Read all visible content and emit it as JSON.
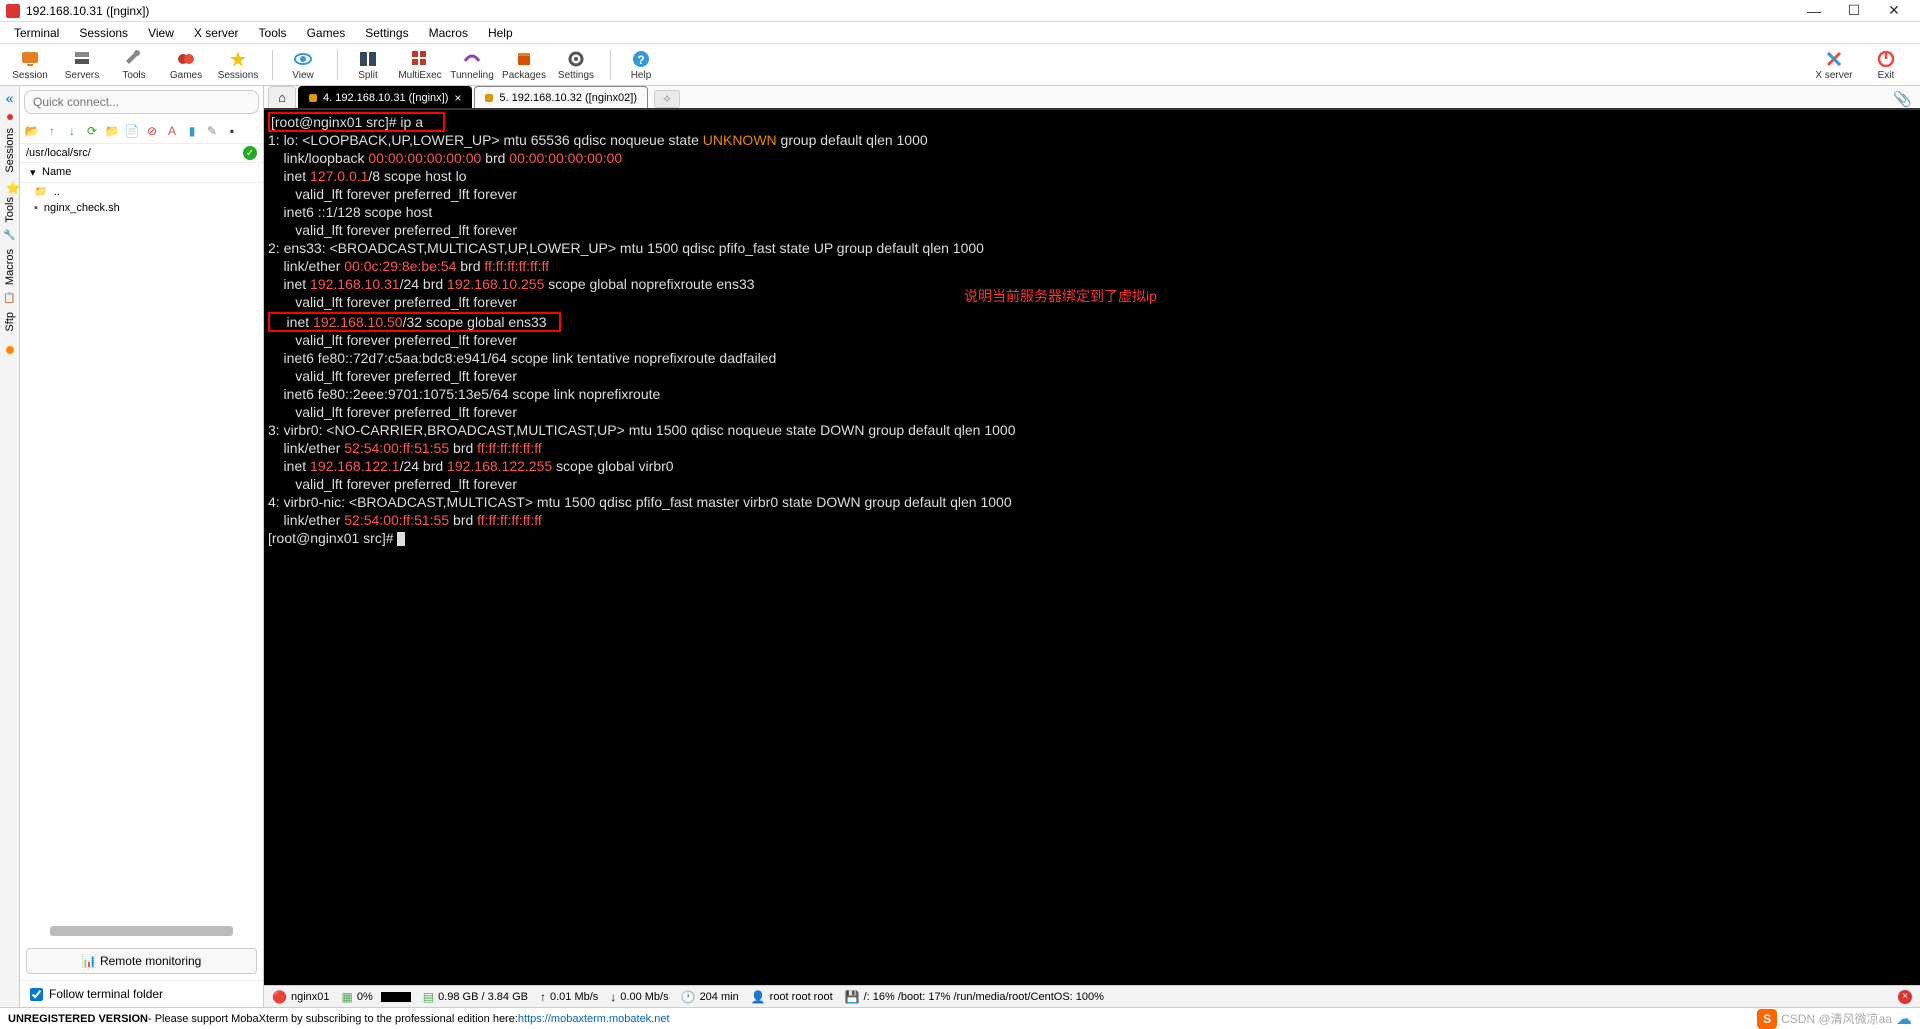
{
  "window": {
    "title": "192.168.10.31 ([nginx])"
  },
  "menubar": [
    "Terminal",
    "Sessions",
    "View",
    "X server",
    "Tools",
    "Games",
    "Settings",
    "Macros",
    "Help"
  ],
  "toolbar": {
    "left": [
      {
        "name": "session",
        "label": "Session",
        "color": "#e67e22"
      },
      {
        "name": "servers",
        "label": "Servers",
        "color": "#888"
      },
      {
        "name": "tools",
        "label": "Tools",
        "color": "#888"
      },
      {
        "name": "games",
        "label": "Games",
        "color": "#c0392b"
      },
      {
        "name": "sessions",
        "label": "Sessions",
        "color": "#16a085"
      }
    ],
    "mid": [
      {
        "name": "view",
        "label": "View",
        "color": "#3498db"
      },
      {
        "name": "split",
        "label": "Split",
        "color": "#2c3e50"
      },
      {
        "name": "multiexec",
        "label": "MultiExec",
        "color": "#c0392b"
      },
      {
        "name": "tunneling",
        "label": "Tunneling",
        "color": "#8e44ad"
      },
      {
        "name": "packages",
        "label": "Packages",
        "color": "#d35400"
      },
      {
        "name": "settings",
        "label": "Settings",
        "color": "#555"
      },
      {
        "name": "help",
        "label": "Help",
        "color": "#3498db"
      }
    ],
    "right": [
      {
        "name": "xserver",
        "label": "X server",
        "color": "#e74c3c"
      },
      {
        "name": "exit",
        "label": "Exit",
        "color": "#e74c3c"
      }
    ]
  },
  "quick_connect_placeholder": "Quick connect...",
  "left_tabs": [
    "Sessions",
    "Tools",
    "Macros",
    "Sftp"
  ],
  "sftp": {
    "path": "/usr/local/src/",
    "header": "Name",
    "rows": [
      {
        "icon": "folder",
        "name": ".."
      },
      {
        "icon": "file",
        "name": "nginx_check.sh"
      }
    ]
  },
  "remote_monitoring_label": "Remote monitoring",
  "follow_label": "Follow terminal folder",
  "tabs": {
    "active": {
      "label": "4. 192.168.10.31 ([nginx])"
    },
    "other": {
      "label": "5. 192.168.10.32 ([nginx02])"
    }
  },
  "terminal": {
    "annotation": "说明当前服务器绑定到了虚拟ip",
    "prompt1_user": "root@nginx01",
    "prompt1_path": "src",
    "cmd": "ip a",
    "iface1_header": "1: lo: <LOOPBACK,UP,LOWER_UP> mtu 65536 qdisc noqueue state ",
    "iface1_state": "UNKNOWN",
    "iface1_tail": " group default qlen 1000",
    "lo_link": "    link/loopback ",
    "lo_mac": "00:00:00:00:00:00",
    "lo_brd_lbl": " brd ",
    "lo_brd": "00:00:00:00:00:00",
    "lo_inet_pre": "    inet ",
    "lo_inet": "127.0.0.1",
    "lo_inet_post": "/8 scope host lo",
    "valid_forever": "       valid_lft forever preferred_lft forever",
    "lo_inet6": "    inet6 ::1/128 scope host ",
    "ens_header": "2: ens33: <BROADCAST,MULTICAST,UP,LOWER_UP> mtu 1500 qdisc pfifo_fast state UP group default qlen 1000",
    "ens_link": "    link/ether ",
    "ens_mac": "00:0c:29:8e:be:54",
    "ens_brd": "ff:ff:ff:ff:ff:ff",
    "ens_inet_pre": "    inet ",
    "ens_ip1": "192.168.10.31",
    "ens_ip1_mid": "/24 brd ",
    "ens_ip1_brd": "192.168.10.255",
    "ens_ip1_post": " scope global noprefixroute ens33",
    "ens_ip2_pre": "    inet ",
    "ens_ip2": "192.168.10.50",
    "ens_ip2_post": "/32 scope global ens33",
    "ens_inet6a": "    inet6 fe80::72d7:c5aa:bdc8:e941/64 scope link tentative noprefixroute dadfailed ",
    "ens_inet6b": "    inet6 fe80::2eee:9701:1075:13e5/64 scope link noprefixroute ",
    "virbr_header": "3: virbr0: <NO-CARRIER,BROADCAST,MULTICAST,UP> mtu 1500 qdisc noqueue state DOWN group default qlen 1000",
    "virbr_link": "    link/ether ",
    "virbr_mac": "52:54:00:ff:51:55",
    "virbr_inet_pre": "    inet ",
    "virbr_ip": "192.168.122.1",
    "virbr_mid": "/24 brd ",
    "virbr_brd": "192.168.122.255",
    "virbr_post": " scope global virbr0",
    "virbrnic_header": "4: virbr0-nic: <BROADCAST,MULTICAST> mtu 1500 qdisc pfifo_fast master virbr0 state DOWN group default qlen 1000",
    "prompt2": "[root@nginx01 src]# "
  },
  "status": {
    "host": "nginx01",
    "cpu": "0%",
    "ram": "0.98 GB / 3.84 GB",
    "up": "0.01 Mb/s",
    "down": "0.00 Mb/s",
    "uptime": "204 min",
    "user": "root  root  root",
    "disk": "/: 16%   /boot: 17%   /run/media/root/CentOS: 100%"
  },
  "footer": {
    "unreg": "UNREGISTERED VERSION",
    "msg": "  -  Please support MobaXterm by subscribing to the professional edition here:  ",
    "link": "https://mobaxterm.mobatek.net",
    "watermark": "CSDN @清风微凉aa"
  }
}
